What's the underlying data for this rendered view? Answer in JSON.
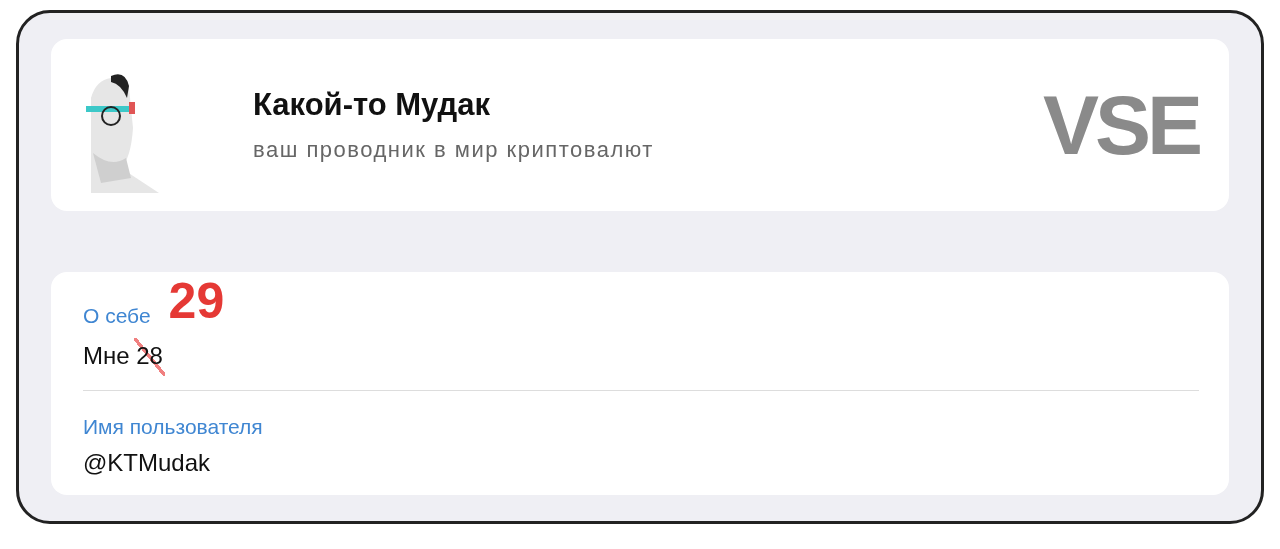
{
  "profile": {
    "name": "Какой-то Мудак",
    "bio": "ваш проводник в мир криптовалют",
    "logo": "VSE"
  },
  "info": [
    {
      "label": "О себе",
      "value_prefix": "Мне ",
      "value_struck": "28",
      "annotation": "29"
    },
    {
      "label": "Имя пользователя",
      "value": "@KTMudak"
    }
  ]
}
